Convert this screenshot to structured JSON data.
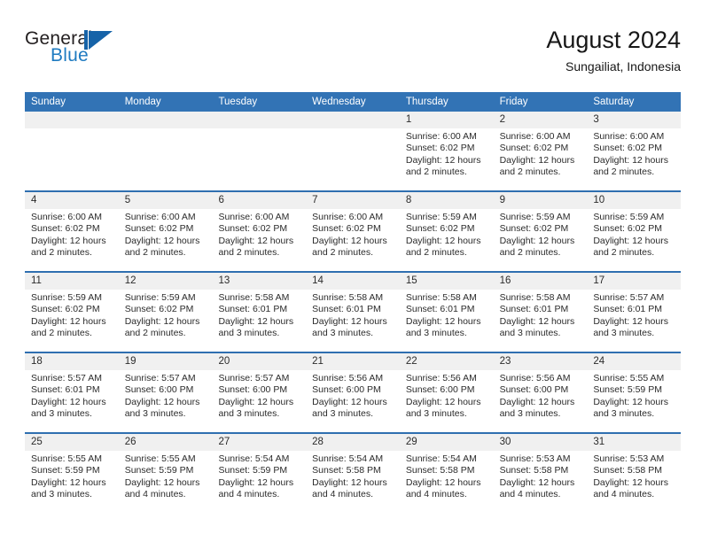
{
  "brand": {
    "name_part1": "General",
    "name_part2": "Blue",
    "mark": "triangle-logo"
  },
  "header": {
    "title": "August 2024",
    "subtitle": "Sungailiat, Indonesia"
  },
  "calendar": {
    "weekday_headers": [
      "Sunday",
      "Monday",
      "Tuesday",
      "Wednesday",
      "Thursday",
      "Friday",
      "Saturday"
    ],
    "colors": {
      "header_blue": "#3273b5",
      "row_separator": "#2f6fb0",
      "number_band": "#f0f0f0",
      "text": "#2b2b2b",
      "brand_blue": "#1f7bc1"
    },
    "weeks": [
      {
        "numbers": [
          "",
          "",
          "",
          "",
          "1",
          "2",
          "3"
        ],
        "cells": [
          {
            "lines": []
          },
          {
            "lines": []
          },
          {
            "lines": []
          },
          {
            "lines": []
          },
          {
            "lines": [
              "Sunrise: 6:00 AM",
              "Sunset: 6:02 PM",
              "Daylight: 12 hours",
              "and 2 minutes."
            ]
          },
          {
            "lines": [
              "Sunrise: 6:00 AM",
              "Sunset: 6:02 PM",
              "Daylight: 12 hours",
              "and 2 minutes."
            ]
          },
          {
            "lines": [
              "Sunrise: 6:00 AM",
              "Sunset: 6:02 PM",
              "Daylight: 12 hours",
              "and 2 minutes."
            ]
          }
        ]
      },
      {
        "numbers": [
          "4",
          "5",
          "6",
          "7",
          "8",
          "9",
          "10"
        ],
        "cells": [
          {
            "lines": [
              "Sunrise: 6:00 AM",
              "Sunset: 6:02 PM",
              "Daylight: 12 hours",
              "and 2 minutes."
            ]
          },
          {
            "lines": [
              "Sunrise: 6:00 AM",
              "Sunset: 6:02 PM",
              "Daylight: 12 hours",
              "and 2 minutes."
            ]
          },
          {
            "lines": [
              "Sunrise: 6:00 AM",
              "Sunset: 6:02 PM",
              "Daylight: 12 hours",
              "and 2 minutes."
            ]
          },
          {
            "lines": [
              "Sunrise: 6:00 AM",
              "Sunset: 6:02 PM",
              "Daylight: 12 hours",
              "and 2 minutes."
            ]
          },
          {
            "lines": [
              "Sunrise: 5:59 AM",
              "Sunset: 6:02 PM",
              "Daylight: 12 hours",
              "and 2 minutes."
            ]
          },
          {
            "lines": [
              "Sunrise: 5:59 AM",
              "Sunset: 6:02 PM",
              "Daylight: 12 hours",
              "and 2 minutes."
            ]
          },
          {
            "lines": [
              "Sunrise: 5:59 AM",
              "Sunset: 6:02 PM",
              "Daylight: 12 hours",
              "and 2 minutes."
            ]
          }
        ]
      },
      {
        "numbers": [
          "11",
          "12",
          "13",
          "14",
          "15",
          "16",
          "17"
        ],
        "cells": [
          {
            "lines": [
              "Sunrise: 5:59 AM",
              "Sunset: 6:02 PM",
              "Daylight: 12 hours",
              "and 2 minutes."
            ]
          },
          {
            "lines": [
              "Sunrise: 5:59 AM",
              "Sunset: 6:02 PM",
              "Daylight: 12 hours",
              "and 2 minutes."
            ]
          },
          {
            "lines": [
              "Sunrise: 5:58 AM",
              "Sunset: 6:01 PM",
              "Daylight: 12 hours",
              "and 3 minutes."
            ]
          },
          {
            "lines": [
              "Sunrise: 5:58 AM",
              "Sunset: 6:01 PM",
              "Daylight: 12 hours",
              "and 3 minutes."
            ]
          },
          {
            "lines": [
              "Sunrise: 5:58 AM",
              "Sunset: 6:01 PM",
              "Daylight: 12 hours",
              "and 3 minutes."
            ]
          },
          {
            "lines": [
              "Sunrise: 5:58 AM",
              "Sunset: 6:01 PM",
              "Daylight: 12 hours",
              "and 3 minutes."
            ]
          },
          {
            "lines": [
              "Sunrise: 5:57 AM",
              "Sunset: 6:01 PM",
              "Daylight: 12 hours",
              "and 3 minutes."
            ]
          }
        ]
      },
      {
        "numbers": [
          "18",
          "19",
          "20",
          "21",
          "22",
          "23",
          "24"
        ],
        "cells": [
          {
            "lines": [
              "Sunrise: 5:57 AM",
              "Sunset: 6:01 PM",
              "Daylight: 12 hours",
              "and 3 minutes."
            ]
          },
          {
            "lines": [
              "Sunrise: 5:57 AM",
              "Sunset: 6:00 PM",
              "Daylight: 12 hours",
              "and 3 minutes."
            ]
          },
          {
            "lines": [
              "Sunrise: 5:57 AM",
              "Sunset: 6:00 PM",
              "Daylight: 12 hours",
              "and 3 minutes."
            ]
          },
          {
            "lines": [
              "Sunrise: 5:56 AM",
              "Sunset: 6:00 PM",
              "Daylight: 12 hours",
              "and 3 minutes."
            ]
          },
          {
            "lines": [
              "Sunrise: 5:56 AM",
              "Sunset: 6:00 PM",
              "Daylight: 12 hours",
              "and 3 minutes."
            ]
          },
          {
            "lines": [
              "Sunrise: 5:56 AM",
              "Sunset: 6:00 PM",
              "Daylight: 12 hours",
              "and 3 minutes."
            ]
          },
          {
            "lines": [
              "Sunrise: 5:55 AM",
              "Sunset: 5:59 PM",
              "Daylight: 12 hours",
              "and 3 minutes."
            ]
          }
        ]
      },
      {
        "numbers": [
          "25",
          "26",
          "27",
          "28",
          "29",
          "30",
          "31"
        ],
        "cells": [
          {
            "lines": [
              "Sunrise: 5:55 AM",
              "Sunset: 5:59 PM",
              "Daylight: 12 hours",
              "and 3 minutes."
            ]
          },
          {
            "lines": [
              "Sunrise: 5:55 AM",
              "Sunset: 5:59 PM",
              "Daylight: 12 hours",
              "and 4 minutes."
            ]
          },
          {
            "lines": [
              "Sunrise: 5:54 AM",
              "Sunset: 5:59 PM",
              "Daylight: 12 hours",
              "and 4 minutes."
            ]
          },
          {
            "lines": [
              "Sunrise: 5:54 AM",
              "Sunset: 5:58 PM",
              "Daylight: 12 hours",
              "and 4 minutes."
            ]
          },
          {
            "lines": [
              "Sunrise: 5:54 AM",
              "Sunset: 5:58 PM",
              "Daylight: 12 hours",
              "and 4 minutes."
            ]
          },
          {
            "lines": [
              "Sunrise: 5:53 AM",
              "Sunset: 5:58 PM",
              "Daylight: 12 hours",
              "and 4 minutes."
            ]
          },
          {
            "lines": [
              "Sunrise: 5:53 AM",
              "Sunset: 5:58 PM",
              "Daylight: 12 hours",
              "and 4 minutes."
            ]
          }
        ]
      }
    ]
  }
}
